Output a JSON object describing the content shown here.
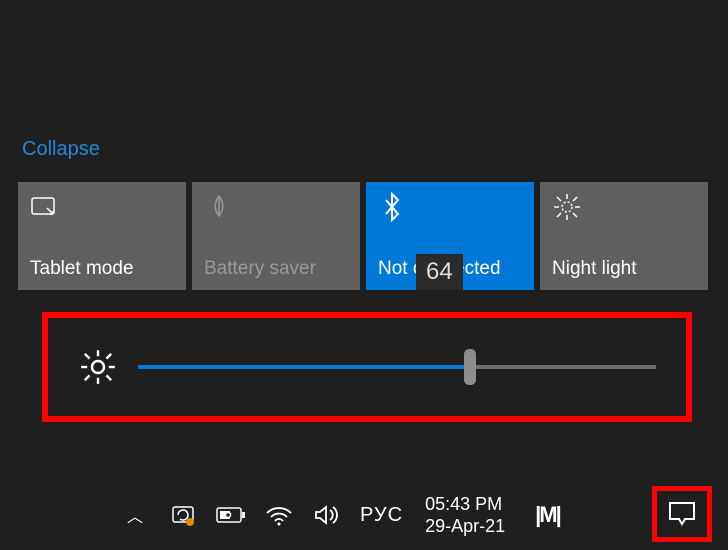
{
  "collapse_label": "Collapse",
  "tiles": [
    {
      "label": "Tablet mode",
      "active": false,
      "dim": false
    },
    {
      "label": "Battery saver",
      "active": false,
      "dim": true
    },
    {
      "label": "Not connected",
      "active": true,
      "dim": false
    },
    {
      "label": "Night light",
      "active": false,
      "dim": false
    }
  ],
  "brightness": {
    "value": 64,
    "tooltip": "64"
  },
  "taskbar": {
    "ime": "РУС",
    "time": "05:43 PM",
    "date": "29-Apr-21",
    "brand": "|M|"
  }
}
